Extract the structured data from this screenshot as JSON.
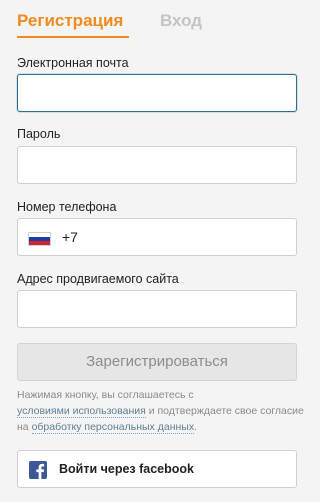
{
  "tabs": {
    "register": "Регистрация",
    "login": "Вход"
  },
  "form": {
    "email_label": "Электронная почта",
    "email_value": "",
    "password_label": "Пароль",
    "password_value": "",
    "phone_label": "Номер телефона",
    "phone_country": "Russia flag",
    "phone_code": "+7",
    "phone_value": "",
    "site_label": "Адрес продвигаемого сайта",
    "site_value": "",
    "submit_label": "Зарегистрироваться"
  },
  "terms": {
    "text_before": "Нажимая кнопку, вы соглашаетесь с",
    "terms_link": "условиями использования",
    "text_middle": "и подтверждаете свое согласие на",
    "data_link": "обработку персональных данных",
    "text_end": "."
  },
  "social": {
    "facebook_label": "Войти через facebook",
    "facebook_icon": "facebook-icon"
  },
  "colors": {
    "accent": "#f08c1e",
    "focus_border": "#2b6f98",
    "facebook": "#3b5998"
  }
}
